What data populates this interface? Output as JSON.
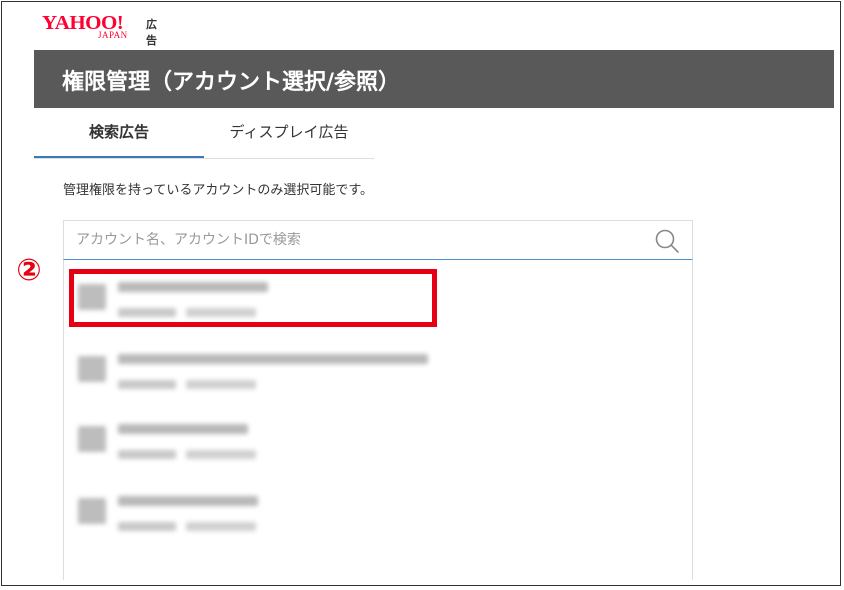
{
  "logo": {
    "brand": "YAHOO!",
    "sub": "JAPAN",
    "product": "広告"
  },
  "header": {
    "title": "権限管理（アカウント選択/参照）"
  },
  "tabs": [
    {
      "label": "検索広告",
      "active": true
    },
    {
      "label": "ディスプレイ広告",
      "active": false
    }
  ],
  "note": "管理権限を持っているアカウントのみ選択可能です。",
  "search": {
    "placeholder": "アカウント名、アカウントIDで検索",
    "value": "",
    "icon": "search-icon"
  },
  "annotation": {
    "marker": "②",
    "color": "#e60012"
  },
  "colors": {
    "title_bar": "#595959",
    "tab_active": "#3b78b6",
    "brand": "#ff0033"
  }
}
